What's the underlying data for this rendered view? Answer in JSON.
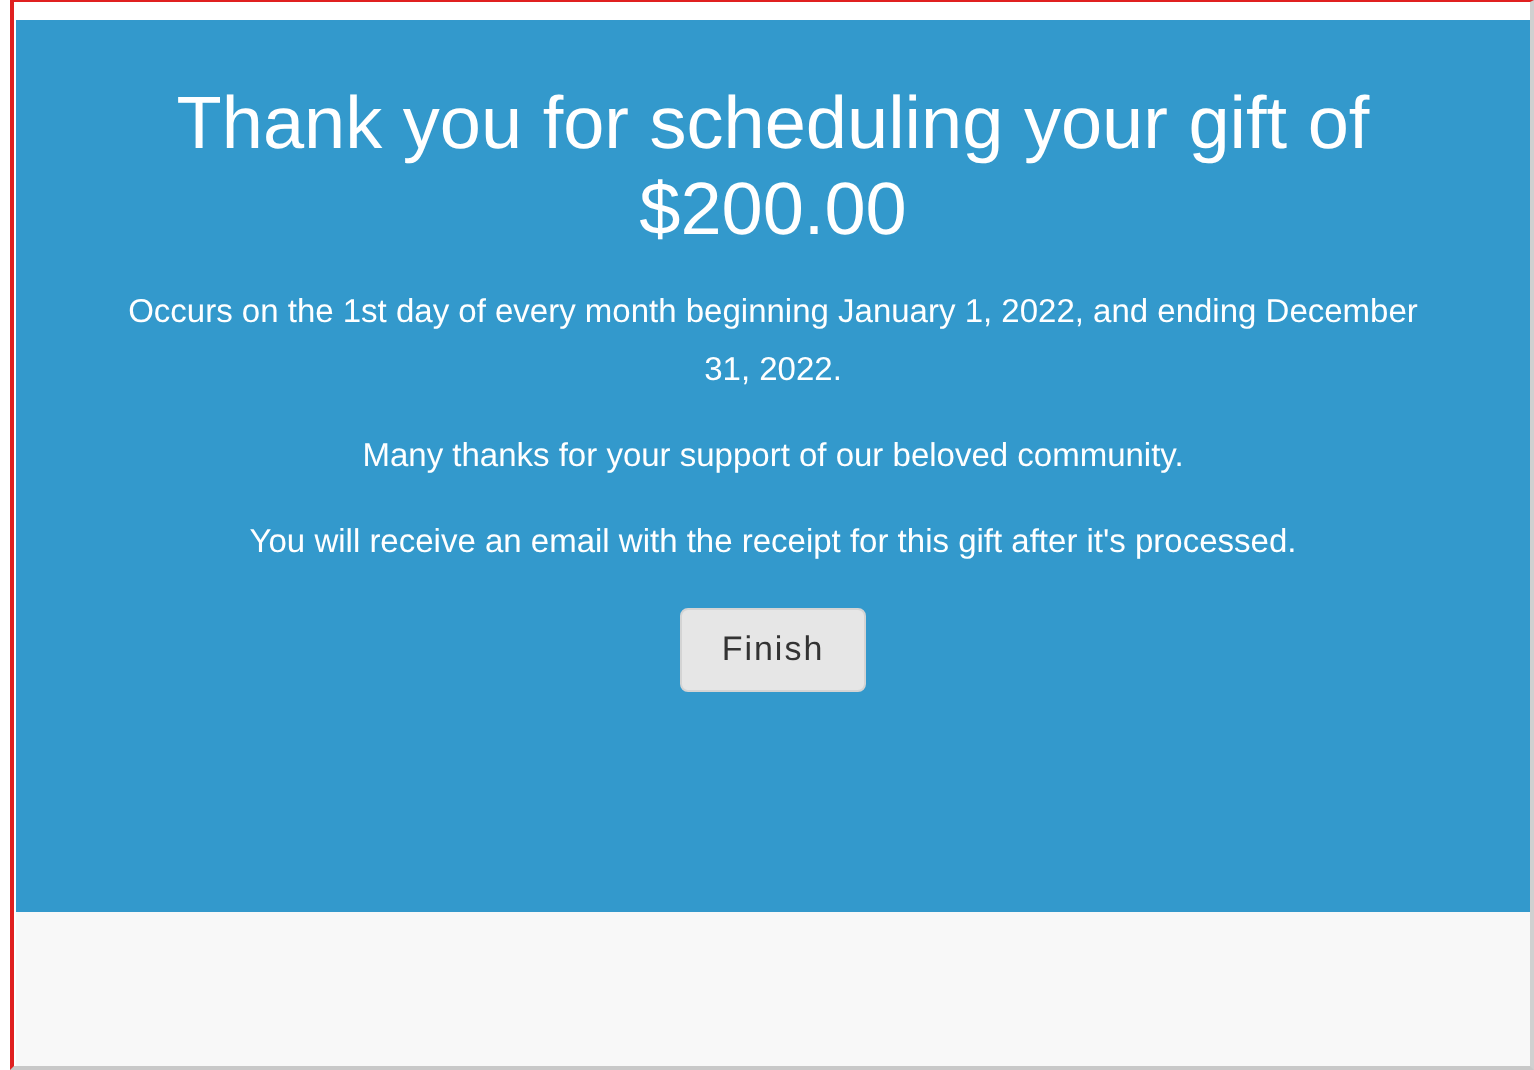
{
  "confirmation": {
    "title": "Thank you for scheduling your gift of $200.00",
    "paragraphs": [
      "Occurs on the 1st day of every month beginning January 1, 2022, and ending December 31, 2022.",
      "Many thanks for your support of our beloved community.",
      "You will receive an email with the receipt for this gift after it's processed."
    ],
    "button": "Finish"
  }
}
